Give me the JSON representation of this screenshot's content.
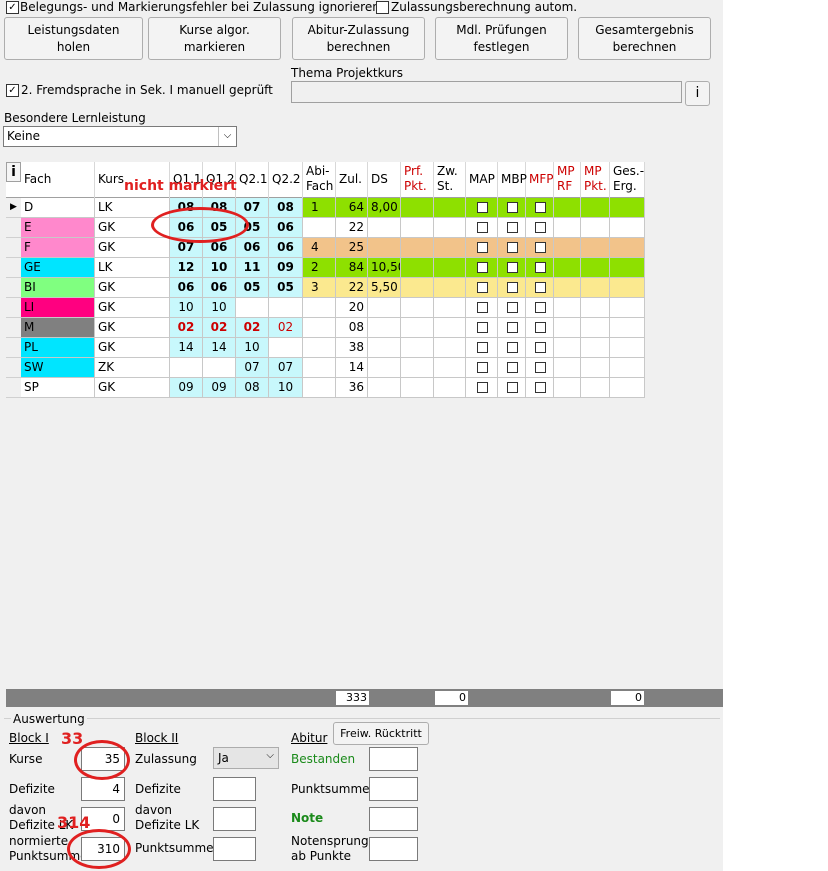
{
  "top": {
    "chk_ignore_label": "Belegungs- und Markierungsfehler bei Zulassung ignorieren",
    "chk_ignore_checked": true,
    "chk_auto_label": "Zulassungsberechnung autom.",
    "chk_auto_checked": false
  },
  "buttons": {
    "b1": "Leistungsdaten\nholen",
    "b2": "Kurse algor.\nmarkieren",
    "b3": "Abitur-Zulassung\nberechnen",
    "b4": "Mdl. Prüfungen\nfestlegen",
    "b5": "Gesamtergebnis\nberechnen"
  },
  "fremd": {
    "label": "2. Fremdsprache in Sek. I manuell geprüft",
    "checked": true
  },
  "projekt": {
    "label": "Thema Projektkurs",
    "value": "",
    "info_label": "i"
  },
  "lernleistung": {
    "label": "Besondere Lernleistung",
    "value": "Keine"
  },
  "grid": {
    "corner": "i",
    "headers": [
      "Fach",
      "Kurs",
      "Q1.1",
      "Q1.2",
      "Q2.1",
      "Q2.2",
      "Abi-\nFach",
      "Zul.",
      "DS",
      "Prf.\nPkt.",
      "Zw.\nSt.",
      "MAP",
      "MBP",
      "MFP",
      "MP\nRF",
      "MP\nPkt.",
      "Ges.-\nErg."
    ],
    "rows": [
      {
        "fach": "D",
        "kurs": "LK",
        "q11": "08",
        "q12": "08",
        "q21": "07",
        "q22": "08",
        "abi": "1",
        "zul": "64",
        "ds": "8,00",
        "current": true
      },
      {
        "fach": "E",
        "kurs": "GK",
        "q11": "06",
        "q12": "05",
        "q21": "05",
        "q22": "06",
        "abi": "",
        "zul": "22",
        "ds": ""
      },
      {
        "fach": "F",
        "kurs": "GK",
        "q11": "07",
        "q12": "06",
        "q21": "06",
        "q22": "06",
        "abi": "4",
        "zul": "25",
        "ds": ""
      },
      {
        "fach": "GE",
        "kurs": "LK",
        "q11": "12",
        "q12": "10",
        "q21": "11",
        "q22": "09",
        "abi": "2",
        "zul": "84",
        "ds": "10,50"
      },
      {
        "fach": "BI",
        "kurs": "GK",
        "q11": "06",
        "q12": "06",
        "q21": "05",
        "q22": "05",
        "abi": "3",
        "zul": "22",
        "ds": "5,50"
      },
      {
        "fach": "LI",
        "kurs": "GK",
        "q11": "10",
        "q12": "10",
        "q21": "",
        "q22": "",
        "abi": "",
        "zul": "20",
        "ds": ""
      },
      {
        "fach": "M",
        "kurs": "GK",
        "q11": "02",
        "q12": "02",
        "q21": "02",
        "q22": "02",
        "abi": "",
        "zul": "08",
        "ds": ""
      },
      {
        "fach": "PL",
        "kurs": "GK",
        "q11": "14",
        "q12": "14",
        "q21": "10",
        "q22": "",
        "abi": "",
        "zul": "38",
        "ds": ""
      },
      {
        "fach": "SW",
        "kurs": "ZK",
        "q11": "",
        "q12": "",
        "q21": "07",
        "q22": "07",
        "abi": "",
        "zul": "14",
        "ds": ""
      },
      {
        "fach": "SP",
        "kurs": "GK",
        "q11": "09",
        "q12": "09",
        "q21": "08",
        "q22": "10",
        "abi": "",
        "zul": "36",
        "ds": ""
      }
    ],
    "sum_zul": "333",
    "sum_prf": "0",
    "sum_ges": "0"
  },
  "auswertung": {
    "title": "Auswertung",
    "block1": "Block I",
    "block2": "Block II",
    "abitur": "Abitur",
    "freiw": "Freiw. Rücktritt",
    "kurse_label": "Kurse",
    "kurse_value": "35",
    "defizite_label": "Defizite",
    "defizite_value": "4",
    "davon_label": "davon\nDefizite LK",
    "davon_value": "0",
    "norm_label": "normierte\nPunktsumme",
    "norm_value": "310",
    "zulassung_label": "Zulassung",
    "zulassung_value": "Ja",
    "defizite2_label": "Defizite",
    "davon2_label": "davon\nDefizite LK",
    "punktsumme2_label": "Punktsumme",
    "bestanden_label": "Bestanden",
    "punktsumme3_label": "Punktsumme",
    "note_label": "Note",
    "notensprung_label": "Notensprung\nab Punkte"
  },
  "annotations": {
    "nicht_markiert": "nicht markiert",
    "n33": "33",
    "n314": "314"
  },
  "colors": {
    "fach_D": "#ffffff",
    "fach_E": "#ff88cc",
    "fach_F": "#ff88cc",
    "fach_GE": "#00e5ff",
    "fach_BI": "#80ff80",
    "fach_LI": "#ff0080",
    "fach_M": "#808080",
    "fach_PL": "#00e5ff",
    "fach_SW": "#00e5ff",
    "fach_SP": "#ffffff",
    "quarter": "#c8f8fc",
    "green_row": "#8ee000",
    "orange_row": "#f2c38a",
    "yellow_row": "#fbe98f",
    "annotation_red": "#e02020",
    "grade_red": "#cc0000"
  }
}
